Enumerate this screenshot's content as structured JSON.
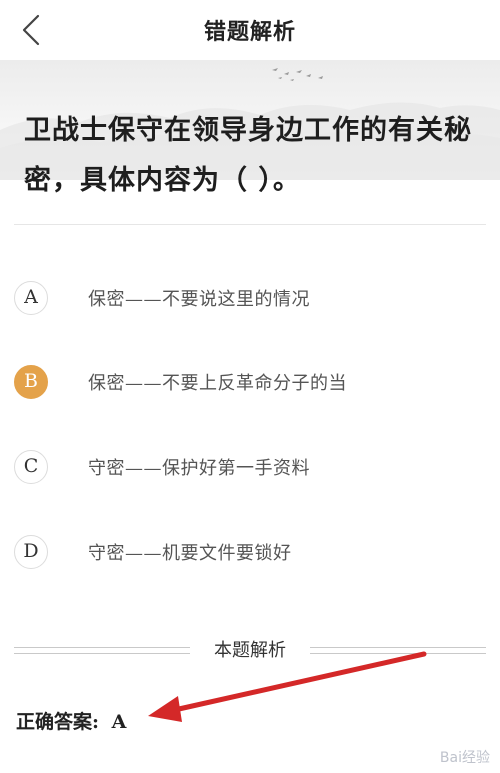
{
  "header": {
    "title": "错题解析"
  },
  "question": {
    "text": "卫战士保守在领导身边工作的有关秘密，具体内容为（   ）。"
  },
  "options": [
    {
      "letter": "A",
      "text": "保密——不要说这里的情况",
      "selected": false
    },
    {
      "letter": "B",
      "text": "保密——不要上反革命分子的当",
      "selected": true
    },
    {
      "letter": "C",
      "text": "守密——保护好第一手资料",
      "selected": false
    },
    {
      "letter": "D",
      "text": "守密——机要文件要锁好",
      "selected": false
    }
  ],
  "analysis": {
    "section_title": "本题解析",
    "answer_label": "正确答案:",
    "answer_value": "A"
  },
  "watermark": {
    "text": "Bai经验"
  },
  "colors": {
    "selected": "#e4a24a",
    "annotation_arrow": "#d42828"
  },
  "icons": {
    "back": "chevron-left-icon"
  }
}
